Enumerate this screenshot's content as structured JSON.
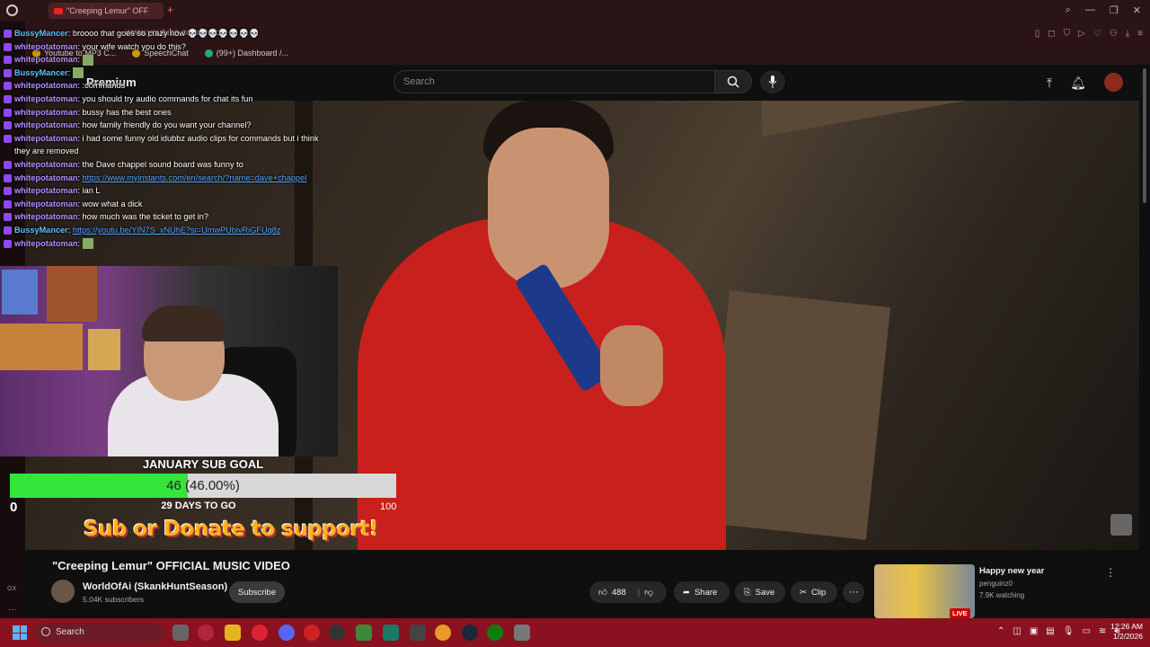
{
  "browser": {
    "tab_title": "\"Creeping Lemur\" OFF",
    "new_tab": "+",
    "address_fragment": "www.youtube.com/watch",
    "bookmarks": [
      {
        "label": "Youtube to MP3 C..."
      },
      {
        "label": "SpeechChat"
      },
      {
        "label": "(99+) Dashboard /..."
      }
    ]
  },
  "youtube": {
    "brand": "Premium",
    "search_placeholder": "Search"
  },
  "chat": {
    "messages": [
      {
        "user": "BussyMancer",
        "text": "broooo that goes so crazy now 💀💀💀💀💀💀💀"
      },
      {
        "user": "whitepotatoman",
        "text": "your wife watch you do this?"
      },
      {
        "user": "whitepotatoman",
        "text": ""
      },
      {
        "user": "BussyMancer",
        "text": ""
      },
      {
        "user": "whitepotatoman",
        "text": ":commands"
      },
      {
        "user": "whitepotatoman",
        "text": "you should try audio commands for chat its fun"
      },
      {
        "user": "whitepotatoman",
        "text": "bussy has the best ones"
      },
      {
        "user": "whitepotatoman",
        "text": "how family friendly do you want your channel?"
      },
      {
        "user": "whitepotatoman",
        "text": "i had some funny old idubbz audio clips for commands but i think they are removed"
      },
      {
        "user": "whitepotatoman",
        "text": "the Dave chappel sound board was funny to"
      },
      {
        "user": "whitepotatoman",
        "link": "https://www.myinstants.com/en/search/?name=dave+chappel"
      },
      {
        "user": "whitepotatoman",
        "text": "ian L"
      },
      {
        "user": "whitepotatoman",
        "text": "wow what a dick"
      },
      {
        "user": "whitepotatoman",
        "text": "how much was the ticket to get in?"
      },
      {
        "user": "BussyMancer",
        "link": "https://youtu.be/YIN7S_xNUhE?si=UmwPUbivRiGFUq8z"
      },
      {
        "user": "whitepotatoman",
        "text": ""
      }
    ]
  },
  "sub_goal": {
    "title": "JANUARY SUB GOAL",
    "current": "46 (46.00%)",
    "progress": 0.46,
    "min": "0",
    "max": "100",
    "days_left": "29 DAYS TO GO",
    "support_text": "Sub or Donate to support!"
  },
  "video": {
    "title": "\"Creeping Lemur\" OFFICIAL MUSIC VIDEO",
    "channel": "WorldOfAi (SkankHuntSeason)",
    "subscribers": "5.04K subscribers",
    "subscribe_label": "Subscribe",
    "likes": "488",
    "share_label": "Share",
    "save_label": "Save",
    "clip_label": "Clip"
  },
  "related": {
    "title": "Happy new year",
    "channel": "penguinz0",
    "watching": "7.9K watching",
    "badge": "LIVE"
  },
  "taskbar": {
    "search_label": "Search",
    "time": "12:26 AM",
    "date": "1/2/2026"
  },
  "side_rail": {
    "label": "GX"
  },
  "colors": {
    "chrome": "#2a1416",
    "taskbar": "#8a1220",
    "goal_fill": "#34e63a",
    "chat_user": "#b98cff",
    "chat_user_alt": "#5cc5ff"
  }
}
